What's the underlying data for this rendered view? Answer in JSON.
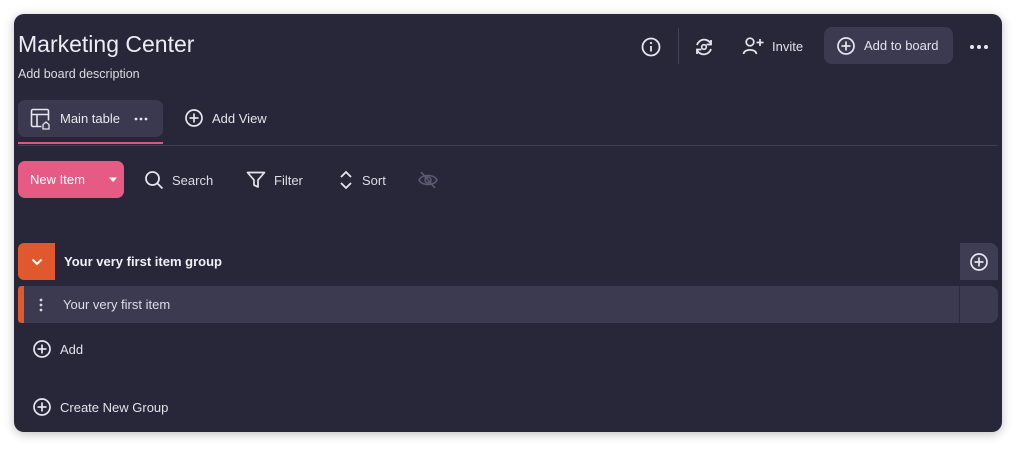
{
  "board": {
    "title": "Marketing Center",
    "description": "Add board description"
  },
  "header": {
    "invite_label": "Invite",
    "add_to_board_label": "Add to board"
  },
  "views": {
    "main_tab_label": "Main table",
    "add_view_label": "Add View"
  },
  "toolbar": {
    "new_item_label": "New Item",
    "search_label": "Search",
    "filter_label": "Filter",
    "sort_label": "Sort"
  },
  "group": {
    "title": "Your very first item group",
    "color": "#e0582e",
    "items": [
      {
        "name": "Your very first item"
      }
    ],
    "add_label": "Add"
  },
  "create_group_label": "Create New Group",
  "colors": {
    "background": "#28273a",
    "accent": "#e55b83",
    "group": "#e0582e"
  }
}
